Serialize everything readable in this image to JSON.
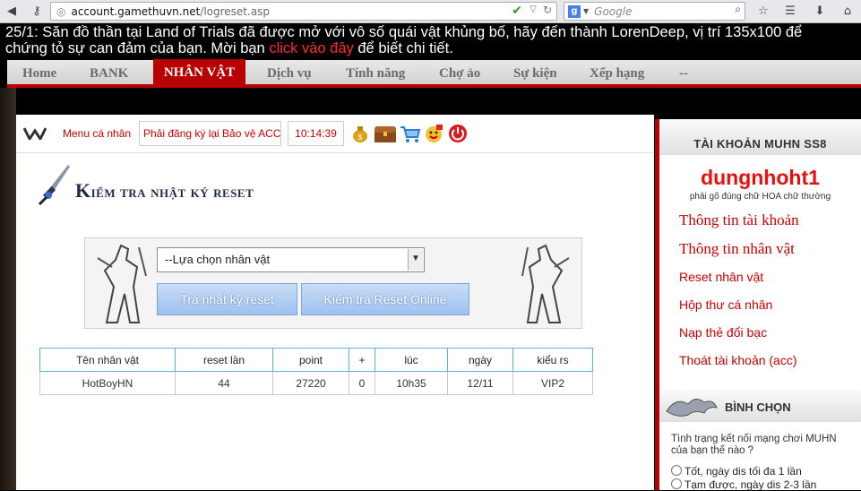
{
  "browser": {
    "url_domain": "account.gamethuvn.net",
    "url_path": "/logreset.asp",
    "search_placeholder": "Google"
  },
  "marquee": {
    "line1": "25/1: Săn đồ thần tại Land of Trials đã được mở với vô số quái vật khủng bố, hãy đến thành LorenDeep, vị trí 135x100 để",
    "line2_a": "chứng tỏ sự can đảm của bạn. Mời bạn ",
    "line2_link": "click vào đây",
    "line2_b": " để biết chi tiết."
  },
  "nav": {
    "items": [
      "Home",
      "BANK",
      "NHÂN VẬT",
      "Dịch vụ",
      "Tính năng",
      "Chợ ảo",
      "Sự kiện",
      "Xếp hạng",
      "--"
    ],
    "active": "NHÂN VẬT"
  },
  "toolbar": {
    "menu_label": "Menu cá nhân",
    "protect_notice": "Phải đăng ký lại Bảo vệ ACC",
    "clock": "10:14:39"
  },
  "page": {
    "title_cap1": "K",
    "title_rest1": "iểm tra nhật ký reset"
  },
  "form": {
    "select_value": "--Lựa chọn nhân vật",
    "btn_view_log": "Tra nhật ký reset",
    "btn_check_online": "Kiểm tra Reset Online"
  },
  "table": {
    "headers": [
      "Tên nhân vật",
      "reset lần",
      "point",
      "+",
      "lúc",
      "ngày",
      "kiểu rs"
    ],
    "rows": [
      [
        "HotBoyHN",
        "44",
        "27220",
        "0",
        "10h35",
        "12/11",
        "VIP2"
      ]
    ]
  },
  "account": {
    "header": "TÀI KHOẢN MUHN SS8",
    "username": "dungnhoht1",
    "hint": "phải gõ đúng chữ HOA chữ thường",
    "links": [
      "Thông tin tài khoản",
      "Thông tin nhân vật",
      "Reset nhân vật",
      "Hộp thư cá nhân",
      "Nạp thẻ đổi bạc",
      "Thoát tài khoản (acc)"
    ]
  },
  "poll": {
    "header": "BÌNH CHỌN",
    "question": "Tình trạng kết nối mạng chơi MUHN của bạn thế nào ?",
    "options": [
      "Tốt, ngày dis tối đa 1 lần",
      "Tạm được, ngày dis 2-3 lần"
    ]
  },
  "colors": {
    "accent_red": "#b80000",
    "link_red": "#cc0000",
    "button_blue": "#9dc1ee"
  }
}
